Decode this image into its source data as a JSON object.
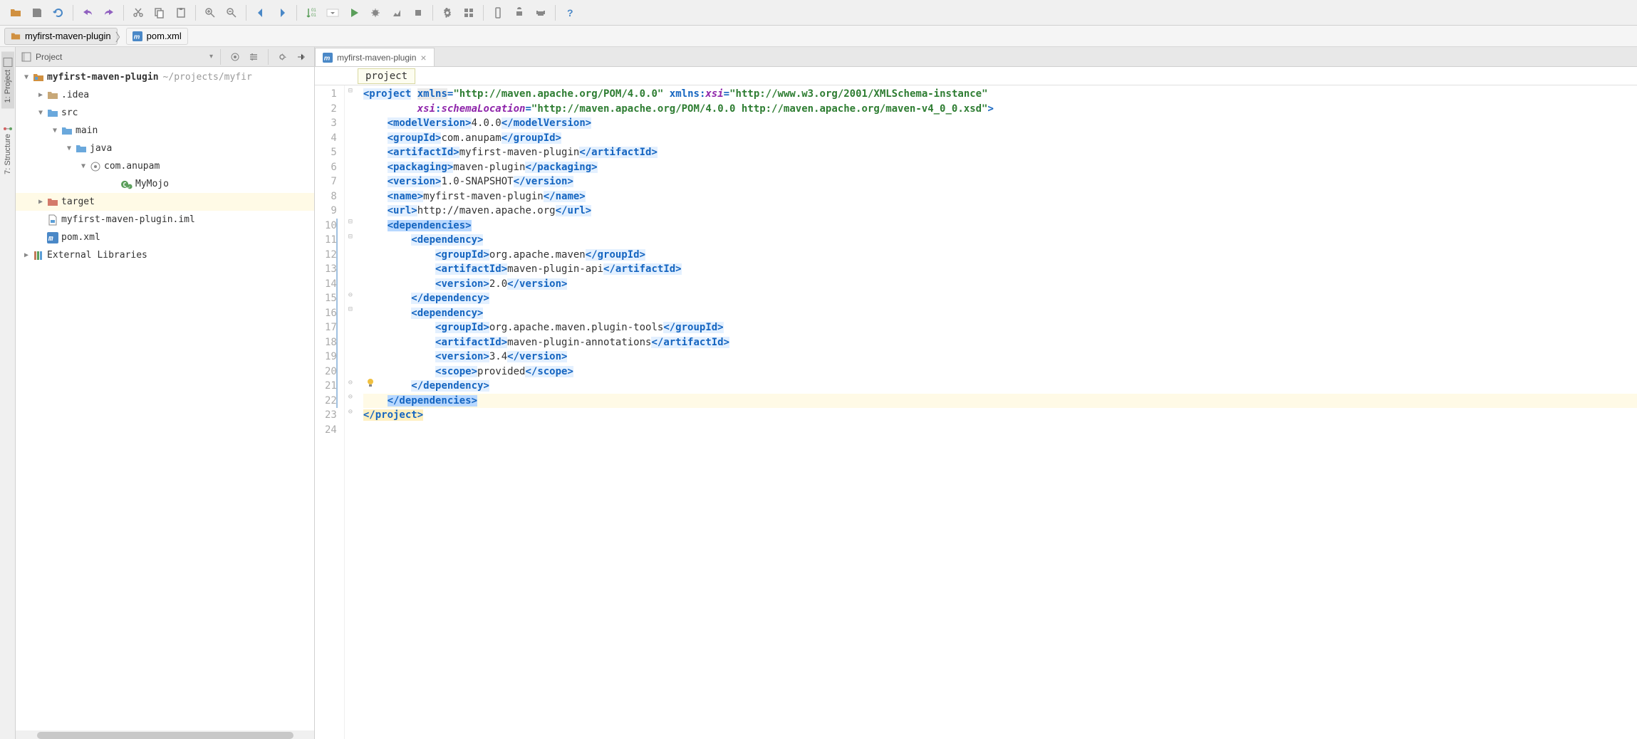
{
  "toolbar": {
    "icons": [
      "open",
      "save",
      "refresh",
      "undo",
      "redo",
      "cut",
      "copy",
      "paste",
      "zoom-in",
      "zoom-out",
      "back",
      "forward",
      "sort",
      "dropdown",
      "run",
      "debug",
      "coverage",
      "stop",
      "settings",
      "project-structure",
      "device",
      "android",
      "avd",
      "help"
    ]
  },
  "breadcrumb": {
    "items": [
      {
        "icon": "folder",
        "label": "myfirst-maven-plugin"
      },
      {
        "icon": "maven",
        "label": "pom.xml"
      }
    ]
  },
  "left_tabs": [
    {
      "id": "project",
      "label": "1: Project",
      "active": true
    },
    {
      "id": "structure",
      "label": "7: Structure",
      "active": false
    }
  ],
  "sidebar": {
    "title": "Project",
    "header_buttons": [
      "target",
      "collapse",
      "settings-gear",
      "hide"
    ]
  },
  "tree": [
    {
      "indent": 0,
      "toggle": "down",
      "icon": "module",
      "label": "myfirst-maven-plugin",
      "bold": true,
      "path": "~/projects/myfir"
    },
    {
      "indent": 1,
      "toggle": "right",
      "icon": "folder",
      "label": ".idea"
    },
    {
      "indent": 1,
      "toggle": "down",
      "icon": "folder-source",
      "label": "src"
    },
    {
      "indent": 2,
      "toggle": "down",
      "icon": "folder-source",
      "label": "main"
    },
    {
      "indent": 3,
      "toggle": "down",
      "icon": "folder-source",
      "label": "java"
    },
    {
      "indent": 4,
      "toggle": "down",
      "icon": "package",
      "label": "com.anupam"
    },
    {
      "indent": 6,
      "toggle": "none",
      "icon": "class",
      "label": "MyMojo",
      "badge": "c-badge"
    },
    {
      "indent": 1,
      "toggle": "right",
      "icon": "folder-excluded",
      "label": "target",
      "current": true
    },
    {
      "indent": 1,
      "toggle": "none",
      "icon": "iml",
      "label": "myfirst-maven-plugin.iml"
    },
    {
      "indent": 1,
      "toggle": "none",
      "icon": "maven",
      "label": "pom.xml"
    },
    {
      "indent": 0,
      "toggle": "right",
      "icon": "libraries",
      "label": "External Libraries"
    }
  ],
  "editor_tab": {
    "icon": "maven",
    "label": "myfirst-maven-plugin"
  },
  "crumb": "project",
  "code": {
    "line_count": 24,
    "lines": [
      {
        "n": 1,
        "html": "<span class='tag hl-tag'>&lt;project</span> <span class='attr-name hl-aname'>xmlns</span><span class='tag'>=</span><span class='attr-val'>\"http://maven.apache.org/POM/4.0.0\"</span> <span class='attr-name'>xmlns</span><span class='tag'>:</span><span class='attr-ns'>xsi</span><span class='tag'>=</span><span class='attr-val'>\"http://www.w3.org/2001/XMLSchema-instance\"</span>",
        "fold": "open"
      },
      {
        "n": 2,
        "html": "         <span class='attr-ns'>xsi</span><span class='tag'>:</span><span class='attr-ns'>schemaLocation</span><span class='tag'>=</span><span class='attr-val'>\"http://maven.apache.org/POM/4.0.0 http://maven.apache.org/maven-v4_0_0.xsd\"</span><span class='tag'>&gt;</span>"
      },
      {
        "n": 3,
        "html": "    <span class='tag hl-tag'>&lt;modelVersion&gt;</span><span class='txt'>4.0.0</span><span class='tag hl-tag'>&lt;/modelVersion&gt;</span>"
      },
      {
        "n": 4,
        "html": "    <span class='tag hl-tag'>&lt;groupId&gt;</span><span class='txt'>com.anupam</span><span class='tag hl-tag'>&lt;/groupId&gt;</span>"
      },
      {
        "n": 5,
        "html": "    <span class='tag hl-tag'>&lt;artifactId&gt;</span><span class='txt'>myfirst-maven-plugin</span><span class='tag hl-tag'>&lt;/artifactId&gt;</span>"
      },
      {
        "n": 6,
        "html": "    <span class='tag hl-tag'>&lt;packaging&gt;</span><span class='txt'>maven-plugin</span><span class='tag hl-tag'>&lt;/packaging&gt;</span>"
      },
      {
        "n": 7,
        "html": "    <span class='tag hl-tag'>&lt;version&gt;</span><span class='txt'>1.0-SNAPSHOT</span><span class='tag hl-tag'>&lt;/version&gt;</span>"
      },
      {
        "n": 8,
        "html": "    <span class='tag hl-tag'>&lt;name&gt;</span><span class='txt'>myfirst-maven-plugin</span><span class='tag hl-tag'>&lt;/name&gt;</span>"
      },
      {
        "n": 9,
        "html": "    <span class='tag hl-tag'>&lt;url&gt;</span><span class='txt'>http://maven.apache.org</span><span class='tag hl-tag'>&lt;/url&gt;</span>"
      },
      {
        "n": 10,
        "html": "    <span class='tag hl-sel'>&lt;dependencies&gt;</span>",
        "fold": "open"
      },
      {
        "n": 11,
        "html": "        <span class='tag hl-tag'>&lt;dependency&gt;</span>",
        "fold": "open"
      },
      {
        "n": 12,
        "html": "            <span class='tag hl-tag'>&lt;groupId&gt;</span><span class='txt'>org.apache.maven</span><span class='tag hl-tag'>&lt;/groupId&gt;</span>"
      },
      {
        "n": 13,
        "html": "            <span class='tag hl-tag'>&lt;artifactId&gt;</span><span class='txt'>maven-plugin-api</span><span class='tag hl-tag'>&lt;/artifactId&gt;</span>"
      },
      {
        "n": 14,
        "html": "            <span class='tag hl-tag'>&lt;version&gt;</span><span class='txt'>2.0</span><span class='tag hl-tag'>&lt;/version&gt;</span>"
      },
      {
        "n": 15,
        "html": "        <span class='tag hl-tag'>&lt;/dependency&gt;</span>",
        "fold": "close"
      },
      {
        "n": 16,
        "html": "        <span class='tag hl-tag'>&lt;dependency&gt;</span>",
        "fold": "open"
      },
      {
        "n": 17,
        "html": "            <span class='tag hl-tag'>&lt;groupId&gt;</span><span class='txt'>org.apache.maven.plugin-tools</span><span class='tag hl-tag'>&lt;/groupId&gt;</span>"
      },
      {
        "n": 18,
        "html": "            <span class='tag hl-tag'>&lt;artifactId&gt;</span><span class='txt'>maven-plugin-annotations</span><span class='tag hl-tag'>&lt;/artifactId&gt;</span>"
      },
      {
        "n": 19,
        "html": "            <span class='tag hl-tag'>&lt;version&gt;</span><span class='txt'>3.4</span><span class='tag hl-tag'>&lt;/version&gt;</span>"
      },
      {
        "n": 20,
        "html": "            <span class='tag hl-tag'>&lt;scope&gt;</span><span class='txt'>provided</span><span class='tag hl-tag'>&lt;/scope&gt;</span>"
      },
      {
        "n": 21,
        "html": "        <span class='tag hl-tag'>&lt;/dependency&gt;</span>",
        "fold": "close",
        "bulb": true
      },
      {
        "n": 22,
        "html": "    <span class='tag hl-sel'>&lt;/dependencies&gt;</span>",
        "hl": true,
        "fold": "close"
      },
      {
        "n": 23,
        "html": "<span class='tag hl-close'>&lt;/project&gt;</span>",
        "fold": "close"
      },
      {
        "n": 24,
        "html": ""
      }
    ]
  }
}
